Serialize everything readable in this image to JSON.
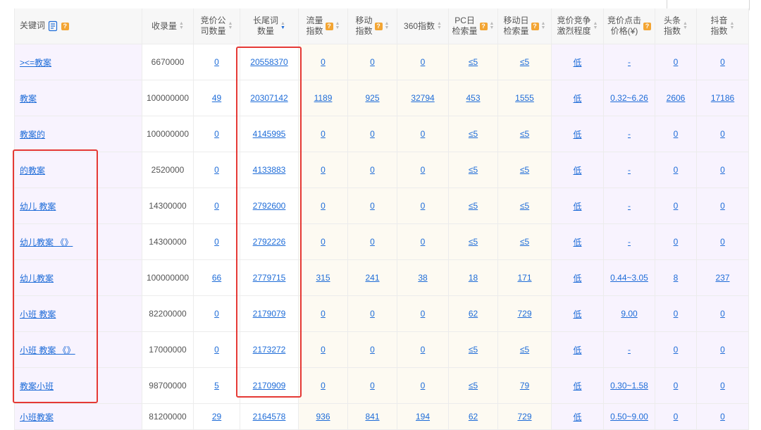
{
  "headers": {
    "keyword": "关键词",
    "index_count": "收录量",
    "bid_companies": "竞价公\n司数量",
    "longtail": "长尾词\n数量",
    "traffic": "流量\n指数",
    "mobile": "移动\n指数",
    "idx360": "360指数",
    "pc_daily": "PC日\n检索量",
    "mobile_daily": "移动日\n检索量",
    "competition": "竞价竞争\n激烈程度",
    "cpc": "竞价点击\n价格(¥)",
    "toutiao": "头条\n指数",
    "douyin": "抖音\n指数"
  },
  "rows": [
    {
      "keyword": "><=教案",
      "index_count": "6670000",
      "bid_companies": "0",
      "longtail": "20558370",
      "traffic": "0",
      "mobile": "0",
      "idx360": "0",
      "pc_daily": "≤5",
      "mobile_daily": "≤5",
      "competition": "低",
      "cpc": "-",
      "toutiao": "0",
      "douyin": "0"
    },
    {
      "keyword": "教案",
      "index_count": "100000000",
      "bid_companies": "49",
      "longtail": "20307142",
      "traffic": "1189",
      "mobile": "925",
      "idx360": "32794",
      "pc_daily": "453",
      "mobile_daily": "1555",
      "competition": "低",
      "cpc": "0.32~6.26",
      "toutiao": "2606",
      "douyin": "17186"
    },
    {
      "keyword": "教案的",
      "index_count": "100000000",
      "bid_companies": "0",
      "longtail": "4145995",
      "traffic": "0",
      "mobile": "0",
      "idx360": "0",
      "pc_daily": "≤5",
      "mobile_daily": "≤5",
      "competition": "低",
      "cpc": "-",
      "toutiao": "0",
      "douyin": "0"
    },
    {
      "keyword": "的教案",
      "index_count": "2520000",
      "bid_companies": "0",
      "longtail": "4133883",
      "traffic": "0",
      "mobile": "0",
      "idx360": "0",
      "pc_daily": "≤5",
      "mobile_daily": "≤5",
      "competition": "低",
      "cpc": "-",
      "toutiao": "0",
      "douyin": "0"
    },
    {
      "keyword": "幼儿 教案",
      "index_count": "14300000",
      "bid_companies": "0",
      "longtail": "2792600",
      "traffic": "0",
      "mobile": "0",
      "idx360": "0",
      "pc_daily": "≤5",
      "mobile_daily": "≤5",
      "competition": "低",
      "cpc": "-",
      "toutiao": "0",
      "douyin": "0"
    },
    {
      "keyword": "幼儿教案 《》",
      "index_count": "14300000",
      "bid_companies": "0",
      "longtail": "2792226",
      "traffic": "0",
      "mobile": "0",
      "idx360": "0",
      "pc_daily": "≤5",
      "mobile_daily": "≤5",
      "competition": "低",
      "cpc": "-",
      "toutiao": "0",
      "douyin": "0"
    },
    {
      "keyword": "幼儿教案",
      "index_count": "100000000",
      "bid_companies": "66",
      "longtail": "2779715",
      "traffic": "315",
      "mobile": "241",
      "idx360": "38",
      "pc_daily": "18",
      "mobile_daily": "171",
      "competition": "低",
      "cpc": "0.44~3.05",
      "toutiao": "8",
      "douyin": "237"
    },
    {
      "keyword": "小班 教案",
      "index_count": "82200000",
      "bid_companies": "0",
      "longtail": "2179079",
      "traffic": "0",
      "mobile": "0",
      "idx360": "0",
      "pc_daily": "62",
      "mobile_daily": "729",
      "competition": "低",
      "cpc": "9.00",
      "toutiao": "0",
      "douyin": "0"
    },
    {
      "keyword": "小班 教案 《》",
      "index_count": "17000000",
      "bid_companies": "0",
      "longtail": "2173272",
      "traffic": "0",
      "mobile": "0",
      "idx360": "0",
      "pc_daily": "≤5",
      "mobile_daily": "≤5",
      "competition": "低",
      "cpc": "-",
      "toutiao": "0",
      "douyin": "0"
    },
    {
      "keyword": "教案小班",
      "index_count": "98700000",
      "bid_companies": "5",
      "longtail": "2170909",
      "traffic": "0",
      "mobile": "0",
      "idx360": "0",
      "pc_daily": "≤5",
      "mobile_daily": "79",
      "competition": "低",
      "cpc": "0.30~1.58",
      "toutiao": "0",
      "douyin": "0"
    },
    {
      "keyword": "小班教案",
      "index_count": "81200000",
      "bid_companies": "29",
      "longtail": "2164578",
      "traffic": "936",
      "mobile": "841",
      "idx360": "194",
      "pc_daily": "62",
      "mobile_daily": "729",
      "competition": "低",
      "cpc": "0.50~9.00",
      "toutiao": "0",
      "douyin": "0"
    }
  ],
  "colors": {
    "link": "#1e6cd8",
    "highlight_box": "#e53935",
    "badge": "#f3a533",
    "row_bg": "#f8f3fe",
    "metric_bg": "#fdfaf2"
  }
}
